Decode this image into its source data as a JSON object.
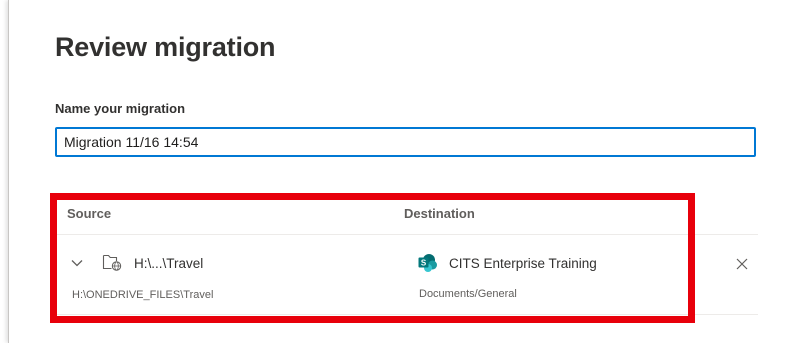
{
  "page": {
    "title": "Review migration"
  },
  "form": {
    "name_label": "Name your migration",
    "name_value": "Migration 11/16 14:54"
  },
  "table": {
    "headers": {
      "source": "Source",
      "destination": "Destination"
    },
    "rows": [
      {
        "source_short": "H:\\...\\Travel",
        "source_full": "H:\\ONEDRIVE_FILES\\Travel",
        "destination_site": "CITS Enterprise Training",
        "destination_library": "Documents/General"
      }
    ]
  },
  "icons": {
    "expand": "chevron-down-icon",
    "source": "network-folder-icon",
    "destination": "sharepoint-icon",
    "remove": "close-icon"
  },
  "colors": {
    "accent": "#0078d4",
    "highlight": "#e8000b",
    "sharepoint": "#038387"
  }
}
